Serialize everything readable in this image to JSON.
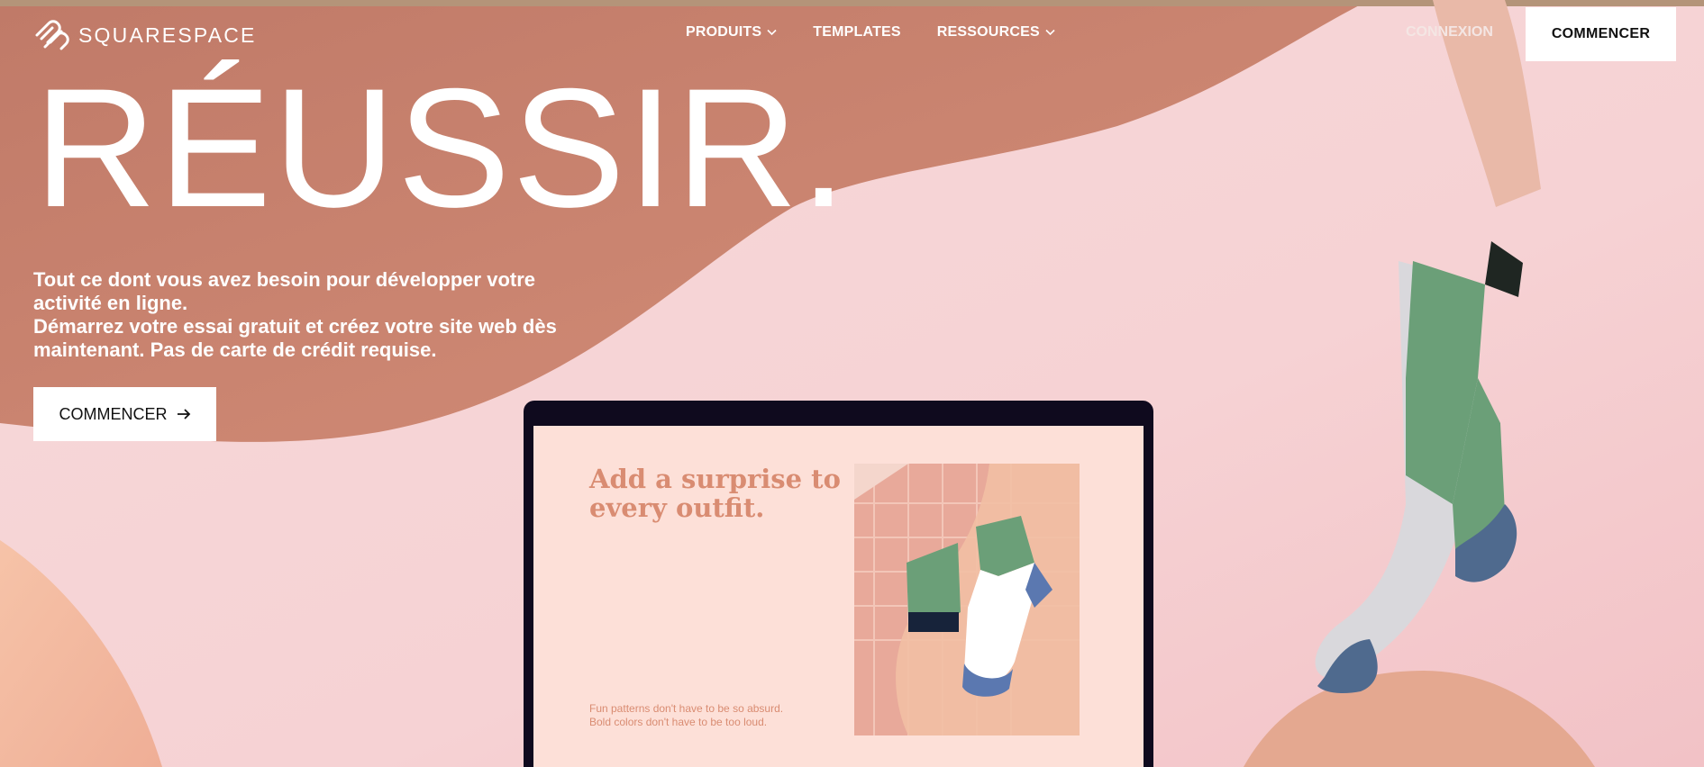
{
  "brand": {
    "name": "SQUARESPACE"
  },
  "nav": {
    "items": [
      {
        "label": "PRODUITS",
        "has_dropdown": true
      },
      {
        "label": "TEMPLATES",
        "has_dropdown": false
      },
      {
        "label": "RESSOURCES",
        "has_dropdown": true
      }
    ],
    "login": "CONNEXION",
    "cta": "COMMENCER"
  },
  "hero": {
    "title": "RÉUSSIR.",
    "subtitle_line1": "Tout ce dont vous avez besoin pour développer votre activité en ligne.",
    "subtitle_line2": "Démarrez votre essai gratuit et créez votre site web dès maintenant. Pas de carte de crédit requise.",
    "cta": "COMMENCER"
  },
  "laptop_screen": {
    "headline": "Add a surprise to every outfit.",
    "small_line1": "Fun patterns don't have to be so absurd.",
    "small_line2": "Bold colors don't have to be too loud."
  },
  "colors": {
    "accent_wave": "#c8806a",
    "background": "#f3cdd0",
    "screen_bg": "#fde0d8",
    "screen_text": "#d98c72",
    "sock_green": "#6b9f78",
    "sock_blue": "#4f6a8e"
  },
  "icons": {
    "logo": "squarespace-logo-icon",
    "dropdown": "chevron-down-icon",
    "cta_arrow": "arrow-right-icon"
  }
}
